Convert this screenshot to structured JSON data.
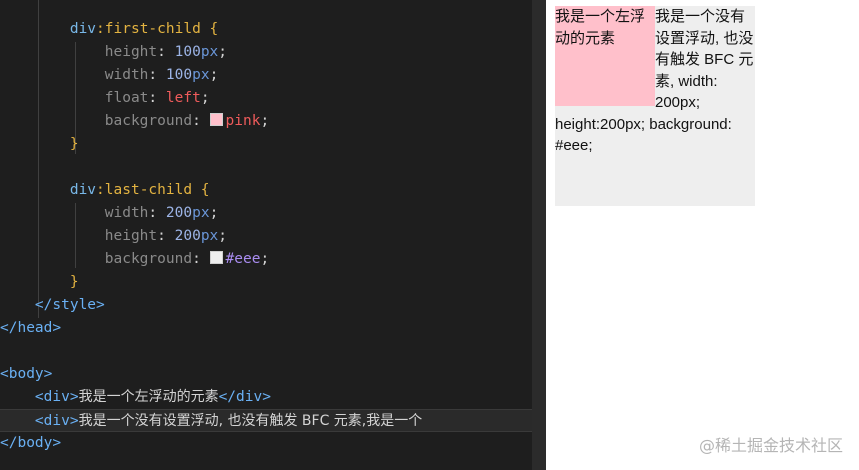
{
  "editor": {
    "lines": [
      {
        "indent": "        ",
        "selector": "div",
        "pseudo": ":first-child",
        "brace": " {"
      },
      {
        "indent": "            ",
        "prop": "height",
        "num": "100",
        "unit": "px"
      },
      {
        "indent": "            ",
        "prop": "width",
        "num": "100",
        "unit": "px"
      },
      {
        "indent": "            ",
        "prop": "float",
        "kw": "left"
      },
      {
        "indent": "            ",
        "prop": "background",
        "swatch": "#ffc0cb",
        "kw": "pink"
      },
      {
        "indent": "        ",
        "brace": "}"
      },
      {
        "indent": "",
        "blank": ""
      },
      {
        "indent": "        ",
        "selector": "div",
        "pseudo": ":last-child",
        "brace": " {"
      },
      {
        "indent": "            ",
        "prop": "width",
        "num": "200",
        "unit": "px"
      },
      {
        "indent": "            ",
        "prop": "height",
        "num": "200",
        "unit": "px"
      },
      {
        "indent": "            ",
        "prop": "background",
        "swatch": "#eeeeee",
        "hex": "#eee"
      },
      {
        "indent": "        ",
        "brace": "}"
      },
      {
        "indent": "    ",
        "tag": "</style>"
      },
      {
        "indent": "",
        "tag": "</head>"
      },
      {
        "indent": "",
        "blank": ""
      },
      {
        "indent": "",
        "tag": "<body>"
      },
      {
        "indent": "    ",
        "tag": "<div>",
        "text": "我是一个左浮动的元素",
        "tag2": "</div>"
      },
      {
        "indent": "    ",
        "tag": "<div>",
        "text": "我是一个没有设置浮动, 也没有触发 BFC 元素,我是一个",
        "current": true
      },
      {
        "indent": "",
        "tag": "</body>"
      }
    ]
  },
  "preview": {
    "float_box_text": "我是一个左浮动的元素",
    "text_box_content": "我是一个没有设置浮动, 也没有触发 BFC 元素, width: 200px; height:200px; background: #eee;"
  },
  "watermark": "@稀土掘金技术社区"
}
